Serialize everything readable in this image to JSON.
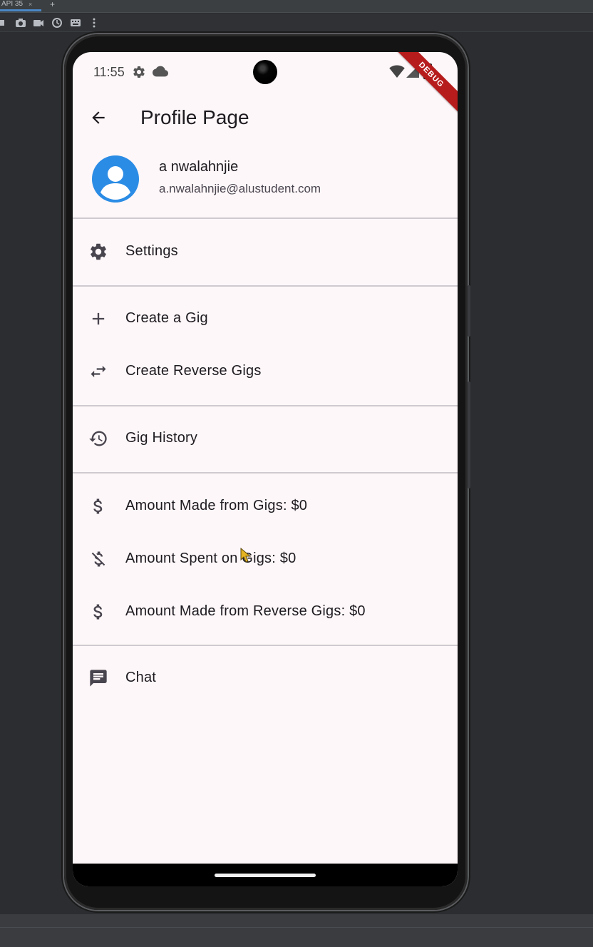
{
  "ide": {
    "tab_label": "API 35",
    "tab_close": "×",
    "plus": "+"
  },
  "status_bar": {
    "time": "11:55",
    "debug_banner": "DEBUG"
  },
  "app_bar": {
    "title": "Profile Page"
  },
  "profile": {
    "name": "a nwalahnjie",
    "email": "a.nwalahnjie@alustudent.com"
  },
  "menu": {
    "settings": "Settings",
    "create_gig": "Create a Gig",
    "create_reverse_gigs": "Create Reverse Gigs",
    "gig_history": "Gig History",
    "amount_made": "Amount Made from Gigs: $0",
    "amount_spent": "Amount Spent on Gigs: $0",
    "amount_made_reverse": "Amount Made from Reverse Gigs: $0",
    "chat": "Chat"
  },
  "colors": {
    "avatar": "#2b8ce5",
    "screen_bg": "#fef7f9",
    "debug_ribbon": "#b71c1c",
    "ide_bg": "#2b2d30"
  },
  "icons": [
    "back-arrow-icon",
    "settings-gear-icon",
    "add-icon",
    "swap-arrows-icon",
    "history-icon",
    "dollar-icon",
    "money-off-icon",
    "dollar-icon",
    "chat-icon"
  ]
}
